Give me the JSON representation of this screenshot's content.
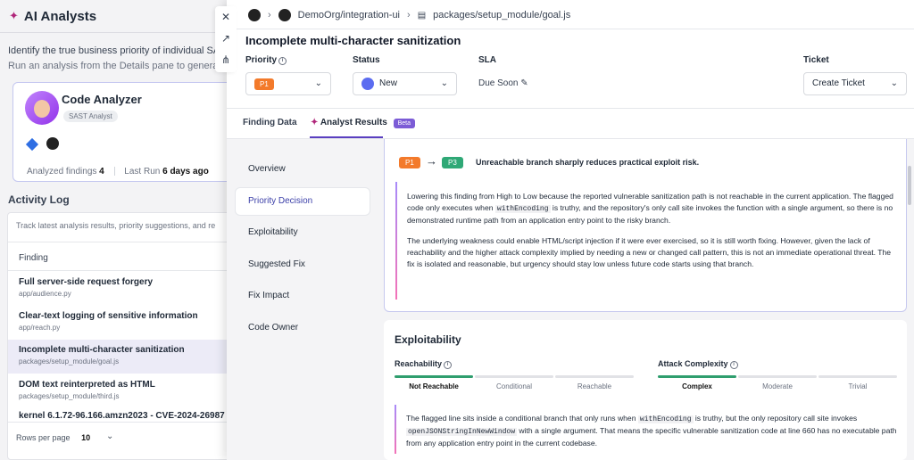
{
  "bg": {
    "title": "AI Analysts",
    "desc1": "Identify the true business priority of individual SAST or St",
    "desc2": "Run an analysis from the Details pane to generate priori",
    "card": {
      "name": "Code Analyzer",
      "tag": "SAST Analyst",
      "analyzed_label": "Analyzed findings",
      "analyzed_value": "4",
      "lastrun_label": "Last Run",
      "lastrun_value": "6 days ago"
    },
    "activity": {
      "title": "Activity Log",
      "search_placeholder": "Track latest analysis results, priority suggestions, and re",
      "column": "Finding",
      "rows": [
        {
          "title": "Full server-side request forgery",
          "sub": "app/audience.py"
        },
        {
          "title": "Clear-text logging of sensitive information",
          "sub": "app/reach.py"
        },
        {
          "title": "Incomplete multi-character sanitization",
          "sub": "packages/setup_module/goal.js"
        },
        {
          "title": "DOM text reinterpreted as HTML",
          "sub": "packages/setup_module/third.js"
        },
        {
          "title": "kernel 6.1.72-96.166.amzn2023 - CVE-2024-26987",
          "sub": ""
        }
      ],
      "rows_per_page_label": "Rows per page",
      "rows_per_page_value": "10"
    }
  },
  "drawer": {
    "breadcrumb": {
      "repo": "DemoOrg/integration-ui",
      "path": "packages/setup_module/goal.js"
    },
    "title": "Incomplete multi-character sanitization",
    "fields": {
      "priority_label": "Priority",
      "priority_value": "P1",
      "status_label": "Status",
      "status_value": "New",
      "sla_label": "SLA",
      "sla_value": "Due Soon",
      "ticket_label": "Ticket",
      "ticket_value": "Create Ticket"
    },
    "tabs": {
      "finding_data": "Finding Data",
      "analyst_results": "Analyst Results",
      "beta": "Beta"
    },
    "nav": [
      "Overview",
      "Priority Decision",
      "Exploitability",
      "Suggested Fix",
      "Fix Impact",
      "Code Owner"
    ],
    "priority_decision": {
      "from": "P1",
      "to": "P3",
      "headline": "Unreachable branch sharply reduces practical exploit risk.",
      "p1a": "Lowering this finding from High to Low because the reported vulnerable sanitization path is not reachable in the current application. The flagged code only executes when ",
      "code1": "withEncoding",
      "p1b": " is truthy, and the repository's only call site invokes the function with a single argument, so there is no demonstrated runtime path from an application entry point to the risky branch.",
      "p2": "The underlying weakness could enable HTML/script injection if it were ever exercised, so it is still worth fixing. However, given the lack of reachability and the higher attack complexity implied by needing a new or changed call pattern, this is not an immediate operational threat. The fix is isolated and reasonable, but urgency should stay low unless future code starts using that branch."
    },
    "exploitability": {
      "title": "Exploitability",
      "reachability_label": "Reachability",
      "reachability_levels": [
        "Not Reachable",
        "Conditional",
        "Reachable"
      ],
      "reachability_selected": "Not Reachable",
      "complexity_label": "Attack Complexity",
      "complexity_levels": [
        "Complex",
        "Moderate",
        "Trivial"
      ],
      "complexity_selected": "Complex",
      "t1": "The flagged line sits inside a conditional branch that only runs when ",
      "c1": "withEncoding",
      "t2": " is truthy, but the only repository call site invokes ",
      "c2": "openJSONStringInNewWindow",
      "t3": " with a single argument. That means the specific vulnerable sanitization code at line 660 has no executable path from any application entry point in the current codebase."
    }
  },
  "colors": {
    "accent": "#5a3fc0",
    "p1": "#f37a2b",
    "p3": "#2fa876",
    "meter_on": "#2f9e6e"
  }
}
